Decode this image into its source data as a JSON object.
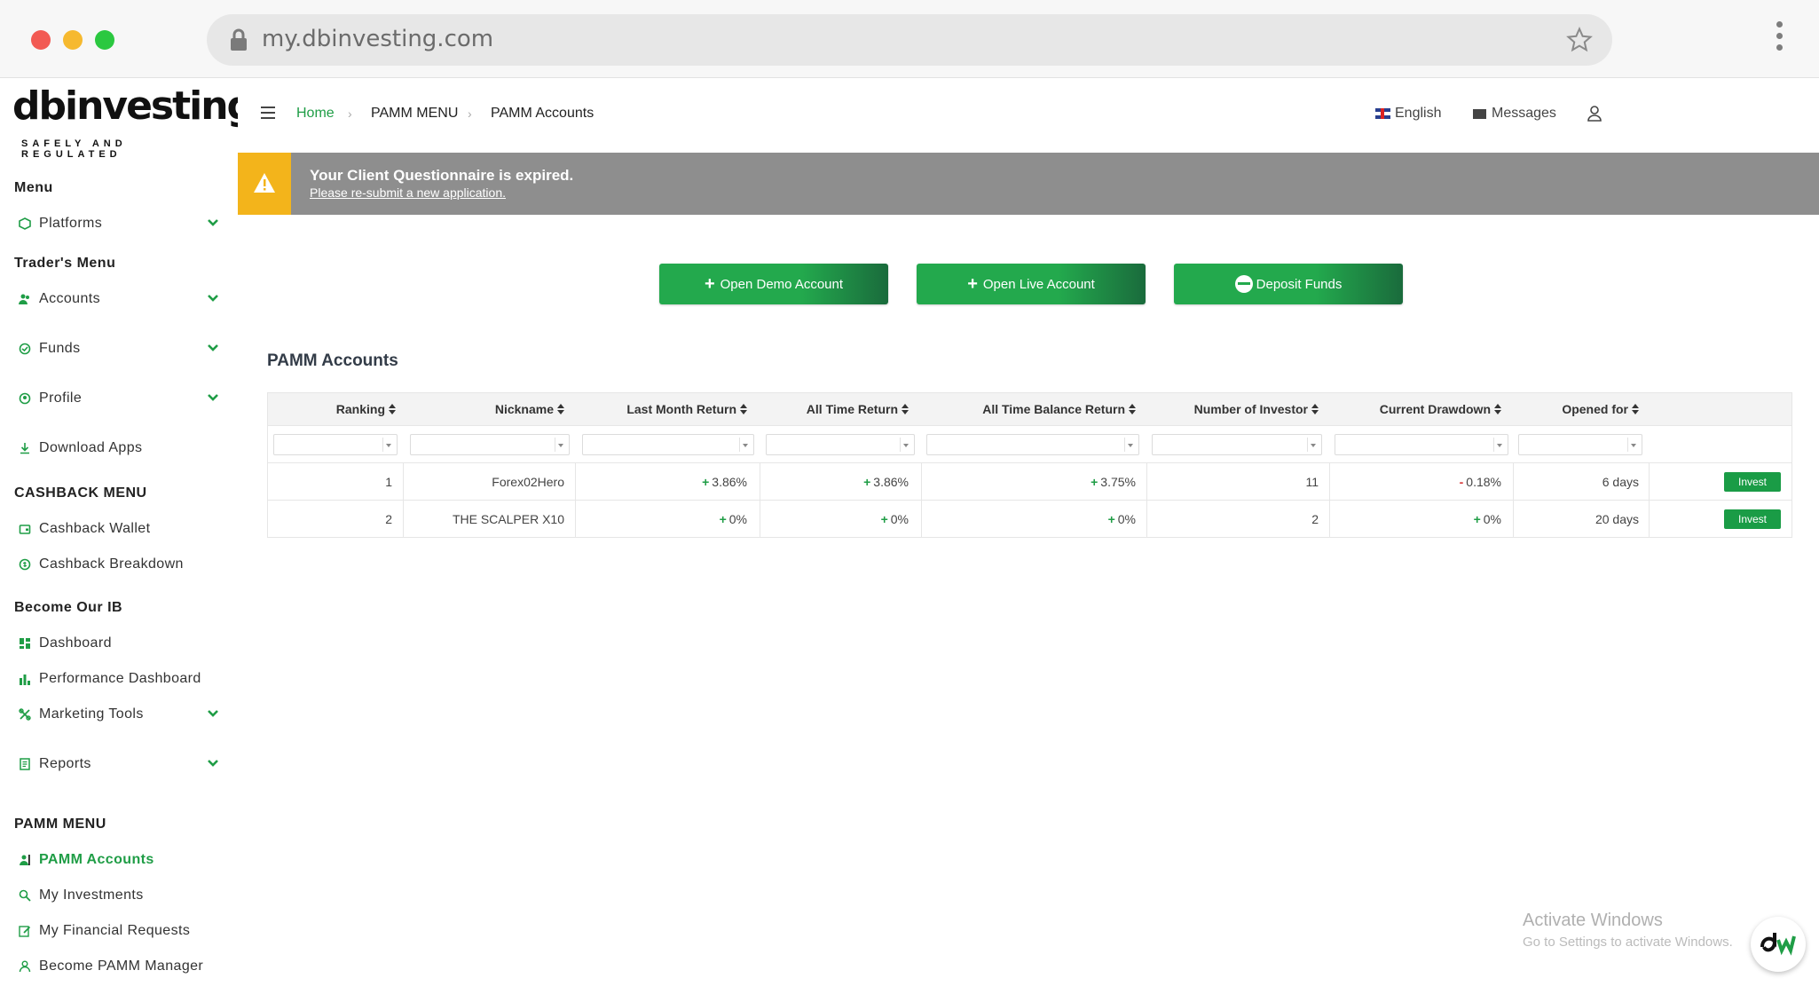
{
  "browser": {
    "url": "my.dbinvesting.com"
  },
  "logo": {
    "wordmark": "dbinvesting",
    "tagline": "SAFELY AND REGULATED"
  },
  "sidebar": {
    "sections": {
      "menu": "Menu",
      "traders_menu": "Trader's Menu",
      "cashback_menu": "CASHBACK MENU",
      "become_ib": "Become Our IB",
      "pamm_menu": "PAMM MENU"
    },
    "items": {
      "platforms": "Platforms",
      "accounts": "Accounts",
      "funds": "Funds",
      "profile": "Profile",
      "download_apps": "Download Apps",
      "cashback_wallet": "Cashback Wallet",
      "cashback_breakdown": "Cashback Breakdown",
      "dashboard": "Dashboard",
      "performance_dashboard": "Performance Dashboard",
      "marketing_tools": "Marketing Tools",
      "reports": "Reports",
      "pamm_accounts": "PAMM Accounts",
      "my_investments": "My Investments",
      "my_financial_requests": "My Financial Requests",
      "become_pamm_manager": "Become PAMM Manager"
    },
    "active_item": "PAMM Accounts"
  },
  "header": {
    "breadcrumb": [
      "Home",
      "PAMM MENU",
      "PAMM Accounts"
    ],
    "language": "English",
    "messages": "Messages"
  },
  "banner": {
    "title": "Your Client Questionnaire is expired.",
    "link": "Please re-submit a new application."
  },
  "actions": {
    "open_demo": "Open Demo Account",
    "open_live": "Open Live Account",
    "deposit": "Deposit Funds"
  },
  "pamm": {
    "title": "PAMM Accounts",
    "columns": [
      "Ranking",
      "Nickname",
      "Last Month Return",
      "All Time Return",
      "All Time Balance Return",
      "Number of Investor",
      "Current Drawdown",
      "Opened for"
    ],
    "rows": [
      {
        "ranking": "1",
        "nickname": "Forex02Hero",
        "last_month": "3.86%",
        "all_time": "3.86%",
        "balance_return": "3.75%",
        "investors": "11",
        "drawdown": "0.18%",
        "opened": "6 days",
        "action": "Invest"
      },
      {
        "ranking": "2",
        "nickname": "THE SCALPER X10",
        "last_month": "0%",
        "all_time": "0%",
        "balance_return": "0%",
        "investors": "2",
        "drawdown": "0%",
        "opened": "20 days",
        "action": "Invest"
      }
    ]
  },
  "watermark": {
    "line1": "Activate Windows",
    "line2": "Go to Settings to activate Windows."
  },
  "colors": {
    "brand_green": "#1f9d46",
    "banner_gray": "#8e8e8e",
    "warning_yellow": "#f3b41b"
  }
}
